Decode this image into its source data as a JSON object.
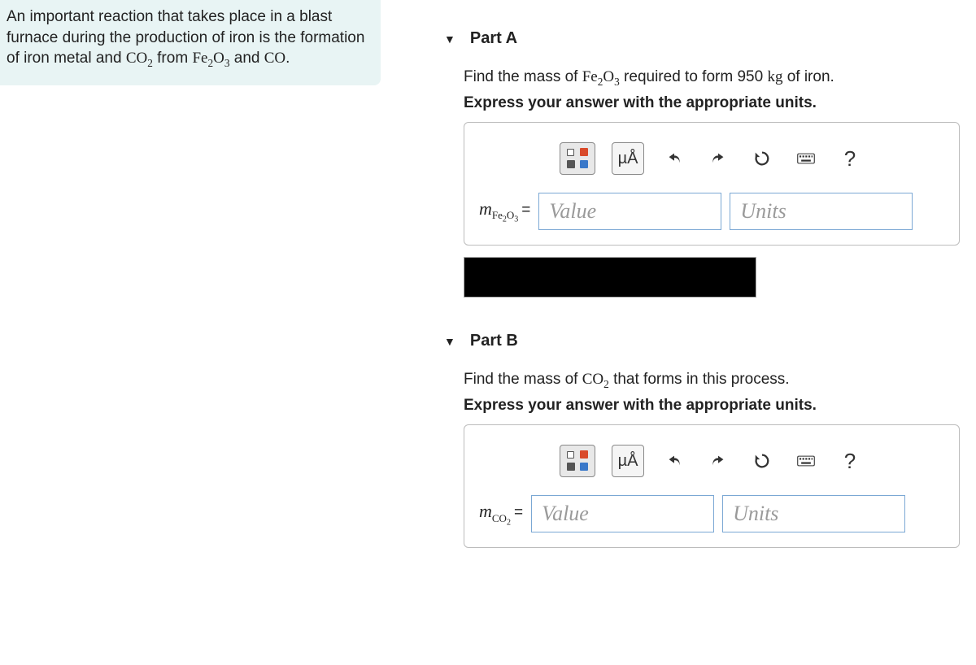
{
  "problem": {
    "intro_plain_1": "An important reaction that takes place in a blast furnace during the production of iron is the formation of iron metal and ",
    "co2": "CO",
    "intro_plain_2": " from ",
    "fe2o3": "Fe",
    "intro_plain_3": " and ",
    "co": "CO",
    "intro_plain_4": "."
  },
  "partA": {
    "title": "Part A",
    "question_pre": "Find the mass of ",
    "question_post": " required to form 950 ",
    "kg": "kg",
    "question_end": " of iron.",
    "instruction": "Express your answer with the appropriate units.",
    "label": "m",
    "value_ph": "Value",
    "units_ph": "Units"
  },
  "partB": {
    "title": "Part B",
    "question_pre": "Find the mass of ",
    "question_post": " that forms in this process.",
    "instruction": "Express your answer with the appropriate units.",
    "label": "m",
    "value_ph": "Value",
    "units_ph": "Units"
  },
  "toolbar": {
    "units_label": "µÅ",
    "help": "?"
  }
}
